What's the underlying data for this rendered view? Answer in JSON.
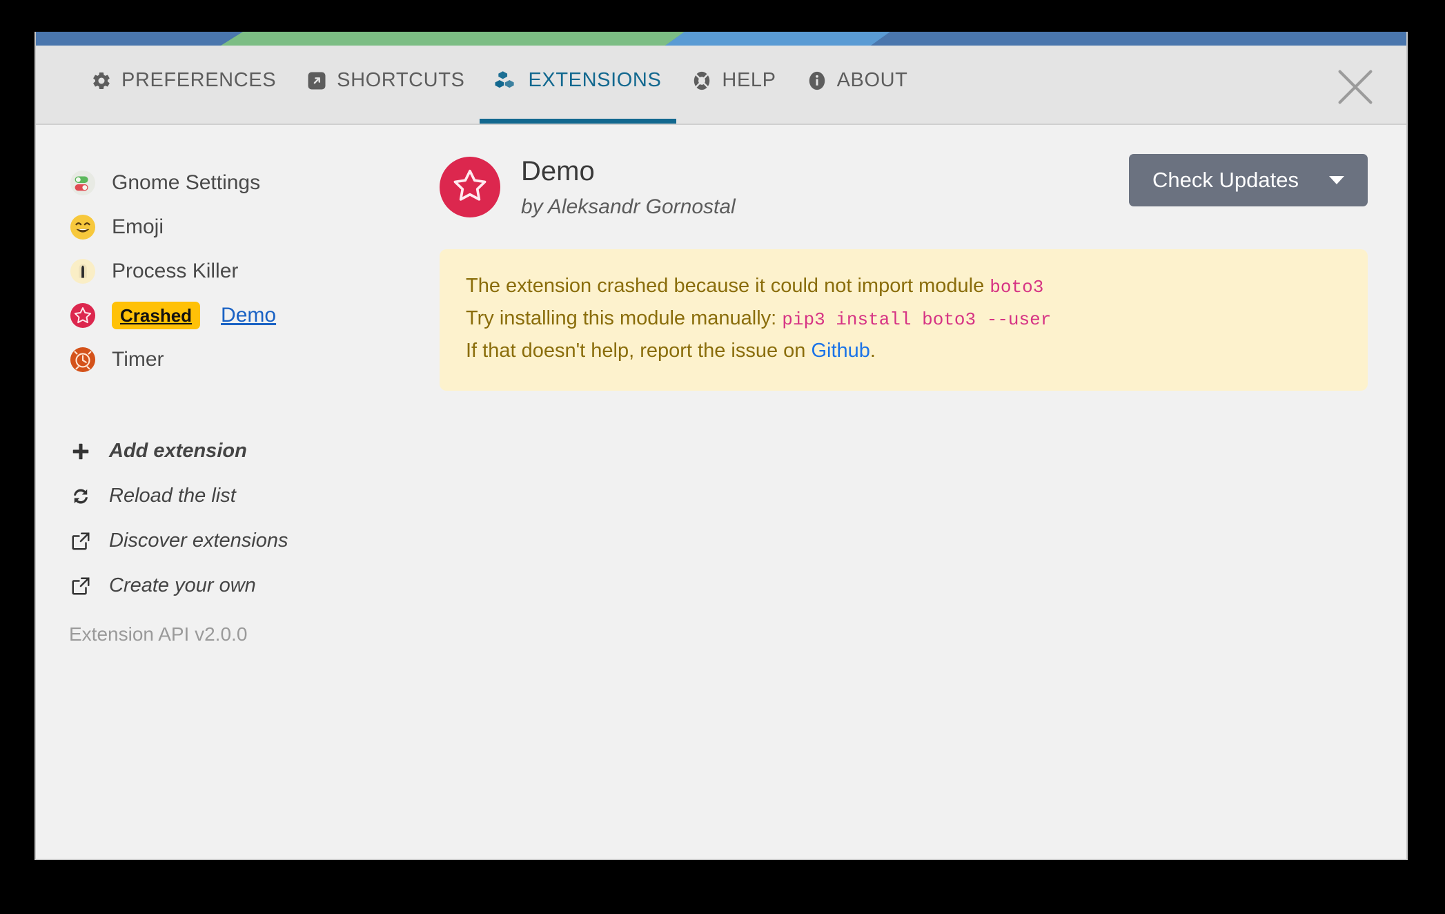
{
  "window": {
    "accent_colors": [
      "#4a76ad",
      "#7cbd84",
      "#5a9bd4",
      "#4a76ad"
    ],
    "close_icon": "close-icon"
  },
  "tabs": [
    {
      "id": "preferences",
      "label": "PREFERENCES",
      "icon": "gear-icon",
      "active": false
    },
    {
      "id": "shortcuts",
      "label": "SHORTCUTS",
      "icon": "external-link-box-icon",
      "active": false
    },
    {
      "id": "extensions",
      "label": "EXTENSIONS",
      "icon": "blocks-icon",
      "active": true
    },
    {
      "id": "help",
      "label": "HELP",
      "icon": "lifebuoy-icon",
      "active": false
    },
    {
      "id": "about",
      "label": "ABOUT",
      "icon": "info-icon",
      "active": false
    }
  ],
  "active_tab_color": "#12688f",
  "sidebar": {
    "extensions": [
      {
        "name": "Gnome Settings",
        "icon": "toggle-switches-icon",
        "badge": null,
        "link": false
      },
      {
        "name": "Emoji",
        "icon": "grinning-face-icon",
        "badge": null,
        "link": false
      },
      {
        "name": "Process Killer",
        "icon": "tombstone-icon",
        "badge": null,
        "link": false
      },
      {
        "name": "Demo",
        "icon": "star-circle-icon",
        "badge": "Crashed",
        "link": true
      },
      {
        "name": "Timer",
        "icon": "alarm-clock-icon",
        "badge": null,
        "link": false
      }
    ],
    "badge_color": "#ffc107",
    "actions": [
      {
        "label": "Add extension",
        "icon": "plus-icon",
        "bold": true
      },
      {
        "label": "Reload the list",
        "icon": "refresh-icon",
        "bold": false
      },
      {
        "label": "Discover extensions",
        "icon": "external-link-icon",
        "bold": false
      },
      {
        "label": "Create your own",
        "icon": "external-link-icon",
        "bold": false
      }
    ],
    "api_version": "Extension API v2.0.0"
  },
  "detail": {
    "avatar_icon": "star-icon",
    "avatar_color": "#dc274e",
    "title": "Demo",
    "author": "by Aleksandr Gornostal",
    "check_updates_label": "Check Updates",
    "check_updates_color": "#6b7280",
    "crash": {
      "line1_text": "The extension crashed because it could not import module ",
      "line1_code": "boto3",
      "line2_text": "Try installing this module manually: ",
      "line2_code": "pip3 install boto3 --user",
      "line3_pre": "If that doesn't help, report the issue on ",
      "line3_link": "Github",
      "line3_post": ".",
      "bg_color": "#fdf2cd",
      "text_color": "#8a6d0b",
      "code_color": "#d63384",
      "link_color": "#1a73e8"
    }
  }
}
